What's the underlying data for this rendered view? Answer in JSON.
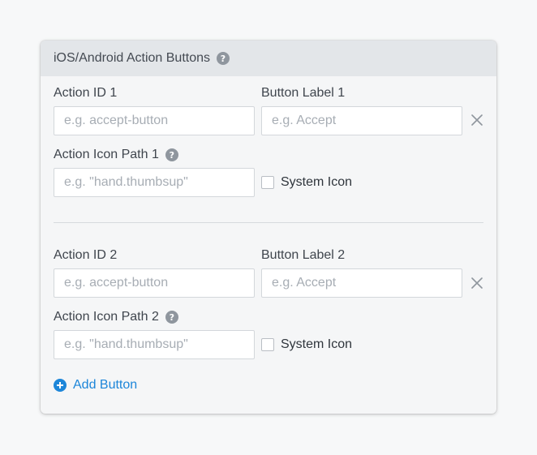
{
  "panel": {
    "title": "iOS/Android Action Buttons",
    "help_icon": "question-circle-icon"
  },
  "actions": [
    {
      "id_label": "Action ID 1",
      "id_placeholder": "e.g. accept-button",
      "id_value": "",
      "button_label": "Button Label 1",
      "button_placeholder": "e.g. Accept",
      "button_value": "",
      "icon_path_label": "Action Icon Path 1",
      "icon_path_placeholder": "e.g. \"hand.thumbsup\"",
      "icon_path_value": "",
      "system_icon_label": "System Icon",
      "system_icon_checked": false,
      "remove_icon": "close-icon"
    },
    {
      "id_label": "Action ID 2",
      "id_placeholder": "e.g. accept-button",
      "id_value": "",
      "button_label": "Button Label 2",
      "button_placeholder": "e.g. Accept",
      "button_value": "",
      "icon_path_label": "Action Icon Path 2",
      "icon_path_placeholder": "e.g. \"hand.thumbsup\"",
      "icon_path_value": "",
      "system_icon_label": "System Icon",
      "system_icon_checked": false,
      "remove_icon": "close-icon"
    }
  ],
  "add_button": {
    "label": "Add Button",
    "icon": "plus-circle-icon"
  },
  "colors": {
    "accent": "#1d86d9",
    "header_bg": "#e3e6e9",
    "panel_bg": "#f5f6f7",
    "help_icon": "#8f969e"
  }
}
